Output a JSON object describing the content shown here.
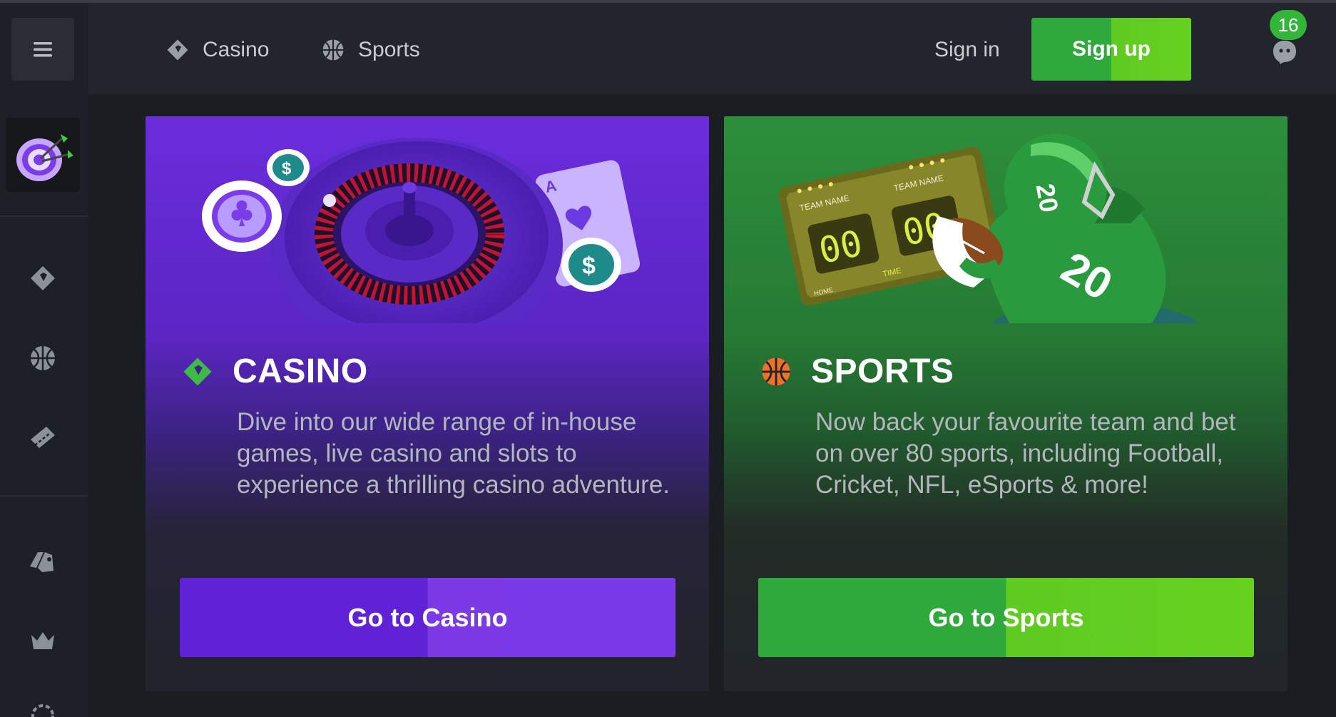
{
  "header": {
    "nav": [
      {
        "label": "Casino",
        "icon": "casino-diamond-icon"
      },
      {
        "label": "Sports",
        "icon": "basketball-icon"
      }
    ],
    "signin_label": "Sign in",
    "signup_label": "Sign up",
    "chat_badge": "16"
  },
  "sidebar": {
    "items": [
      {
        "icon": "menu-icon"
      },
      {
        "icon": "dart-target-icon"
      },
      {
        "icon": "casino-diamond-icon"
      },
      {
        "icon": "basketball-icon"
      },
      {
        "icon": "ticket-icon"
      },
      {
        "icon": "promotions-icon"
      },
      {
        "icon": "crown-icon"
      },
      {
        "icon": "more-icon"
      }
    ]
  },
  "cards": {
    "casino": {
      "title": "CASINO",
      "description": "Dive into our wide range of in-house games, live casino and slots to experience a thrilling casino adventure.",
      "button": "Go to Casino"
    },
    "sports": {
      "title": "SPORTS",
      "description": "Now back your favourite team and bet on over 80 sports, including Football, Cricket, NFL, eSports & more!",
      "button": "Go to Sports",
      "scoreboard": {
        "team_left": "TEAM NAME",
        "team_right": "TEAM NAME",
        "score_left": "00",
        "score_right": "00",
        "time_label": "TIME",
        "home_label": "HOME",
        "jersey_number": "20"
      }
    }
  },
  "colors": {
    "accent_green": "#33b53c",
    "casino_purple": "#6a2ddc",
    "sports_green": "#2c8f3a"
  }
}
